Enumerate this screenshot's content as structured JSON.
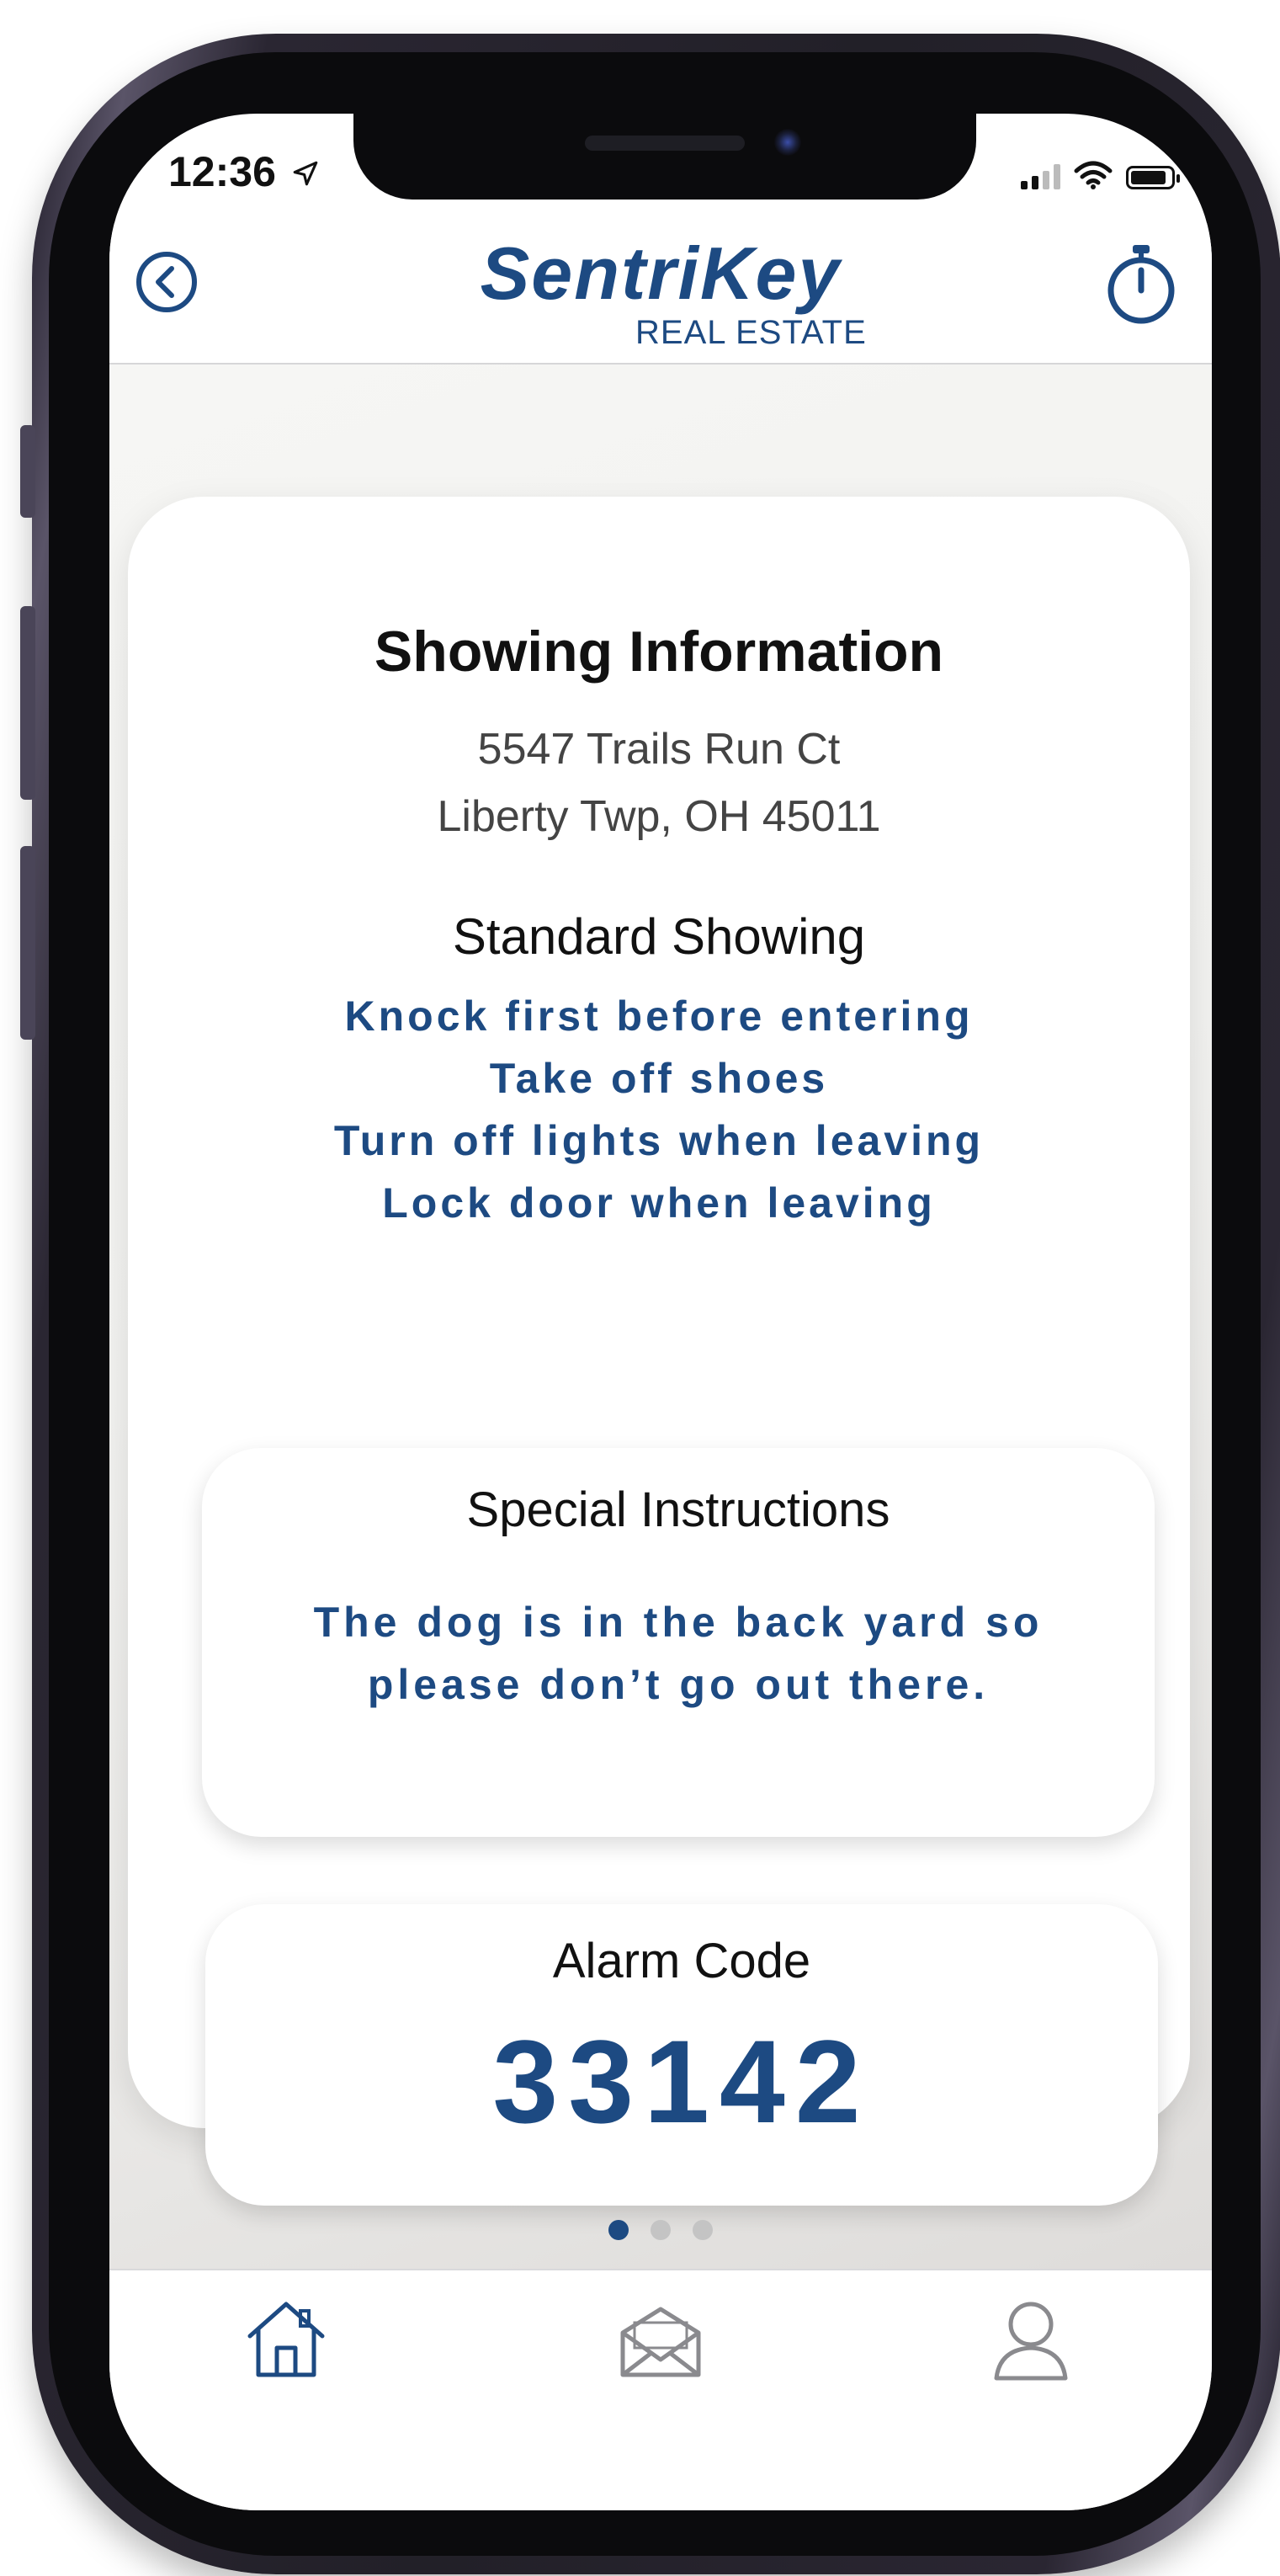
{
  "status_bar": {
    "time": "12:36"
  },
  "header": {
    "logo_main": "SentriKey",
    "logo_sub": "REAL ESTATE",
    "back_icon": "chevron-left-circle-icon",
    "timer_icon": "stopwatch-icon"
  },
  "showing": {
    "title": "Showing Information",
    "address_line1": "5547 Trails Run Ct",
    "address_line2": "Liberty Twp, OH 45011",
    "type": "Standard Showing",
    "instructions": [
      "Knock first before entering",
      "Take off shoes",
      "Turn off lights when leaving",
      "Lock door when leaving"
    ]
  },
  "special": {
    "title": "Special Instructions",
    "line1": "The dog is in the back yard so",
    "line2": "please don’t go out there."
  },
  "alarm": {
    "title": "Alarm Code",
    "code": "33142"
  },
  "pager": {
    "count": 3,
    "active_index": 0
  },
  "tabs": [
    {
      "name": "home",
      "icon": "home-icon",
      "active": true
    },
    {
      "name": "messages",
      "icon": "envelope-icon",
      "active": false
    },
    {
      "name": "profile",
      "icon": "user-icon",
      "active": false
    }
  ],
  "colors": {
    "brand": "#1d4a82",
    "inactive_icon": "#8a8a8e"
  }
}
